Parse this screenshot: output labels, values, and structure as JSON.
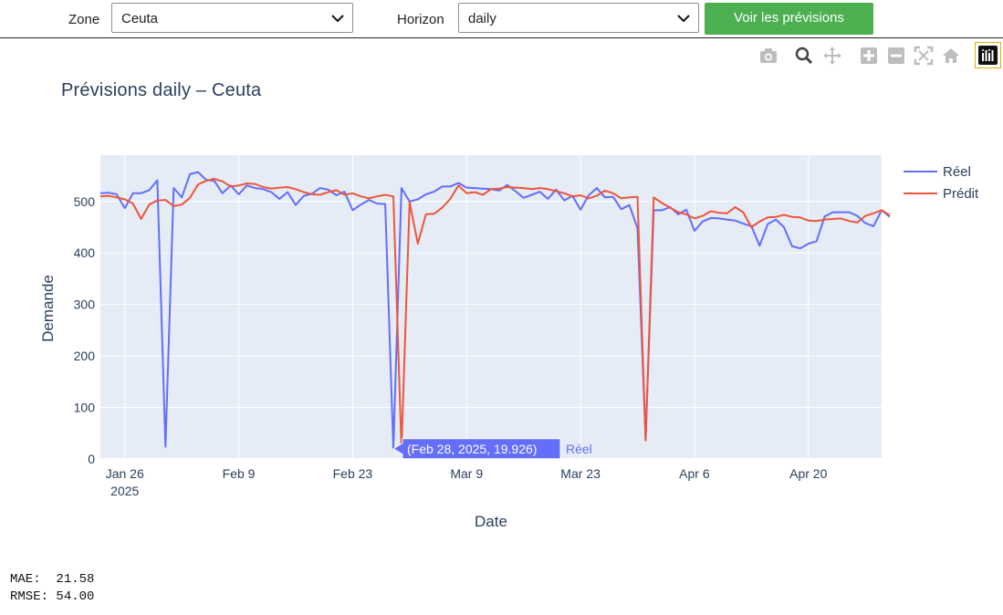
{
  "controls": {
    "zone_label": "Zone",
    "zone_value": "Ceuta",
    "horizon_label": "Horizon",
    "horizon_value": "daily",
    "submit_label": "Voir les prévisions"
  },
  "modebar": {
    "icons": [
      "camera-icon",
      "zoom-icon",
      "pan-icon",
      "zoom-in-icon",
      "zoom-out-icon",
      "autoscale-icon",
      "reset-axes-icon",
      "plotly-logo-icon"
    ]
  },
  "metrics": {
    "mae_label": "MAE:",
    "mae_value": "21.58",
    "rmse_label": "RMSE:",
    "rmse_value": "54.00"
  },
  "colors": {
    "reel": "#636efa",
    "predit": "#ef553b",
    "plot_bg": "#e5ecf6",
    "button": "#4caf50"
  },
  "chart_data": {
    "type": "line",
    "title": "Prévisions daily – Ceuta",
    "xlabel": "Date",
    "ylabel": "Demande",
    "ylim": [
      0,
      590
    ],
    "yticks": [
      0,
      100,
      200,
      300,
      400,
      500
    ],
    "x_range": [
      "2025-01-23",
      "2025-04-29"
    ],
    "xticks": [
      {
        "date": "2025-01-26",
        "label": "Jan 26",
        "sublabel": "2025"
      },
      {
        "date": "2025-02-09",
        "label": "Feb 9"
      },
      {
        "date": "2025-02-23",
        "label": "Feb 23"
      },
      {
        "date": "2025-03-09",
        "label": "Mar 9"
      },
      {
        "date": "2025-03-23",
        "label": "Mar 23"
      },
      {
        "date": "2025-04-06",
        "label": "Apr 6"
      },
      {
        "date": "2025-04-20",
        "label": "Apr 20"
      }
    ],
    "x_start": "2025-01-23",
    "legend_position": "top-right",
    "grid": true,
    "series": [
      {
        "name": "Réel",
        "color": "#636efa",
        "values": [
          516,
          517,
          514,
          487,
          516,
          516,
          522,
          541,
          24,
          526,
          508,
          553,
          557,
          542,
          540,
          516,
          531,
          514,
          531,
          526,
          524,
          518,
          505,
          518,
          493,
          511,
          515,
          526,
          523,
          512,
          519,
          483,
          494,
          503,
          496,
          495,
          20,
          526,
          500,
          504,
          514,
          519,
          529,
          529,
          536,
          527,
          526,
          525,
          524,
          521,
          532,
          520,
          507,
          513,
          519,
          505,
          523,
          502,
          511,
          484,
          512,
          526,
          508,
          509,
          485,
          493,
          448,
          39,
          483,
          483,
          489,
          475,
          484,
          443,
          461,
          468,
          467,
          465,
          463,
          457,
          452,
          414,
          456,
          465,
          450,
          413,
          409,
          418,
          423,
          471,
          479,
          479,
          479,
          472,
          458,
          452,
          483,
          470
        ],
        "hover": {
          "date": "Feb 28, 2025",
          "value": "19.926",
          "index": 36
        }
      },
      {
        "name": "Prédit",
        "color": "#ef553b",
        "values": [
          510,
          511,
          508,
          504,
          496,
          466,
          494,
          502,
          503,
          491,
          494,
          507,
          533,
          540,
          544,
          539,
          529,
          531,
          535,
          534,
          528,
          525,
          527,
          528,
          524,
          518,
          514,
          513,
          518,
          522,
          513,
          516,
          510,
          506,
          510,
          513,
          510,
          20,
          499,
          418,
          475,
          476,
          488,
          505,
          531,
          516,
          518,
          513,
          524,
          525,
          528,
          527,
          526,
          524,
          526,
          524,
          520,
          516,
          510,
          512,
          506,
          511,
          521,
          516,
          506,
          508,
          509,
          36,
          508,
          497,
          488,
          479,
          475,
          467,
          472,
          481,
          478,
          477,
          489,
          479,
          450,
          461,
          469,
          470,
          474,
          470,
          469,
          463,
          462,
          465,
          466,
          467,
          462,
          459,
          472,
          477,
          483,
          473
        ]
      }
    ]
  }
}
